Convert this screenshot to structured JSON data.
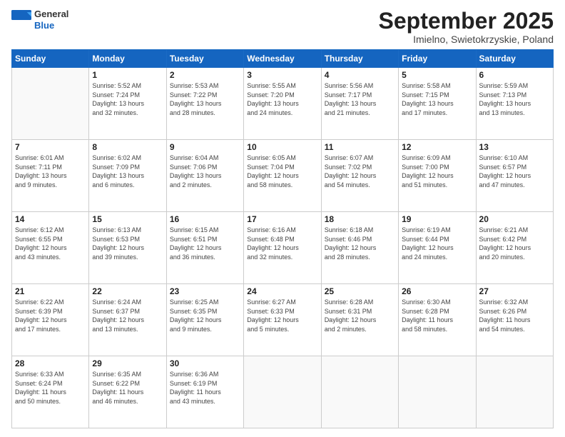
{
  "logo": {
    "general": "General",
    "blue": "Blue"
  },
  "header": {
    "month": "September 2025",
    "location": "Imielno, Swietokrzyskie, Poland"
  },
  "weekdays": [
    "Sunday",
    "Monday",
    "Tuesday",
    "Wednesday",
    "Thursday",
    "Friday",
    "Saturday"
  ],
  "weeks": [
    [
      {
        "day": "",
        "info": ""
      },
      {
        "day": "1",
        "info": "Sunrise: 5:52 AM\nSunset: 7:24 PM\nDaylight: 13 hours\nand 32 minutes."
      },
      {
        "day": "2",
        "info": "Sunrise: 5:53 AM\nSunset: 7:22 PM\nDaylight: 13 hours\nand 28 minutes."
      },
      {
        "day": "3",
        "info": "Sunrise: 5:55 AM\nSunset: 7:20 PM\nDaylight: 13 hours\nand 24 minutes."
      },
      {
        "day": "4",
        "info": "Sunrise: 5:56 AM\nSunset: 7:17 PM\nDaylight: 13 hours\nand 21 minutes."
      },
      {
        "day": "5",
        "info": "Sunrise: 5:58 AM\nSunset: 7:15 PM\nDaylight: 13 hours\nand 17 minutes."
      },
      {
        "day": "6",
        "info": "Sunrise: 5:59 AM\nSunset: 7:13 PM\nDaylight: 13 hours\nand 13 minutes."
      }
    ],
    [
      {
        "day": "7",
        "info": "Sunrise: 6:01 AM\nSunset: 7:11 PM\nDaylight: 13 hours\nand 9 minutes."
      },
      {
        "day": "8",
        "info": "Sunrise: 6:02 AM\nSunset: 7:09 PM\nDaylight: 13 hours\nand 6 minutes."
      },
      {
        "day": "9",
        "info": "Sunrise: 6:04 AM\nSunset: 7:06 PM\nDaylight: 13 hours\nand 2 minutes."
      },
      {
        "day": "10",
        "info": "Sunrise: 6:05 AM\nSunset: 7:04 PM\nDaylight: 12 hours\nand 58 minutes."
      },
      {
        "day": "11",
        "info": "Sunrise: 6:07 AM\nSunset: 7:02 PM\nDaylight: 12 hours\nand 54 minutes."
      },
      {
        "day": "12",
        "info": "Sunrise: 6:09 AM\nSunset: 7:00 PM\nDaylight: 12 hours\nand 51 minutes."
      },
      {
        "day": "13",
        "info": "Sunrise: 6:10 AM\nSunset: 6:57 PM\nDaylight: 12 hours\nand 47 minutes."
      }
    ],
    [
      {
        "day": "14",
        "info": "Sunrise: 6:12 AM\nSunset: 6:55 PM\nDaylight: 12 hours\nand 43 minutes."
      },
      {
        "day": "15",
        "info": "Sunrise: 6:13 AM\nSunset: 6:53 PM\nDaylight: 12 hours\nand 39 minutes."
      },
      {
        "day": "16",
        "info": "Sunrise: 6:15 AM\nSunset: 6:51 PM\nDaylight: 12 hours\nand 36 minutes."
      },
      {
        "day": "17",
        "info": "Sunrise: 6:16 AM\nSunset: 6:48 PM\nDaylight: 12 hours\nand 32 minutes."
      },
      {
        "day": "18",
        "info": "Sunrise: 6:18 AM\nSunset: 6:46 PM\nDaylight: 12 hours\nand 28 minutes."
      },
      {
        "day": "19",
        "info": "Sunrise: 6:19 AM\nSunset: 6:44 PM\nDaylight: 12 hours\nand 24 minutes."
      },
      {
        "day": "20",
        "info": "Sunrise: 6:21 AM\nSunset: 6:42 PM\nDaylight: 12 hours\nand 20 minutes."
      }
    ],
    [
      {
        "day": "21",
        "info": "Sunrise: 6:22 AM\nSunset: 6:39 PM\nDaylight: 12 hours\nand 17 minutes."
      },
      {
        "day": "22",
        "info": "Sunrise: 6:24 AM\nSunset: 6:37 PM\nDaylight: 12 hours\nand 13 minutes."
      },
      {
        "day": "23",
        "info": "Sunrise: 6:25 AM\nSunset: 6:35 PM\nDaylight: 12 hours\nand 9 minutes."
      },
      {
        "day": "24",
        "info": "Sunrise: 6:27 AM\nSunset: 6:33 PM\nDaylight: 12 hours\nand 5 minutes."
      },
      {
        "day": "25",
        "info": "Sunrise: 6:28 AM\nSunset: 6:31 PM\nDaylight: 12 hours\nand 2 minutes."
      },
      {
        "day": "26",
        "info": "Sunrise: 6:30 AM\nSunset: 6:28 PM\nDaylight: 11 hours\nand 58 minutes."
      },
      {
        "day": "27",
        "info": "Sunrise: 6:32 AM\nSunset: 6:26 PM\nDaylight: 11 hours\nand 54 minutes."
      }
    ],
    [
      {
        "day": "28",
        "info": "Sunrise: 6:33 AM\nSunset: 6:24 PM\nDaylight: 11 hours\nand 50 minutes."
      },
      {
        "day": "29",
        "info": "Sunrise: 6:35 AM\nSunset: 6:22 PM\nDaylight: 11 hours\nand 46 minutes."
      },
      {
        "day": "30",
        "info": "Sunrise: 6:36 AM\nSunset: 6:19 PM\nDaylight: 11 hours\nand 43 minutes."
      },
      {
        "day": "",
        "info": ""
      },
      {
        "day": "",
        "info": ""
      },
      {
        "day": "",
        "info": ""
      },
      {
        "day": "",
        "info": ""
      }
    ]
  ]
}
